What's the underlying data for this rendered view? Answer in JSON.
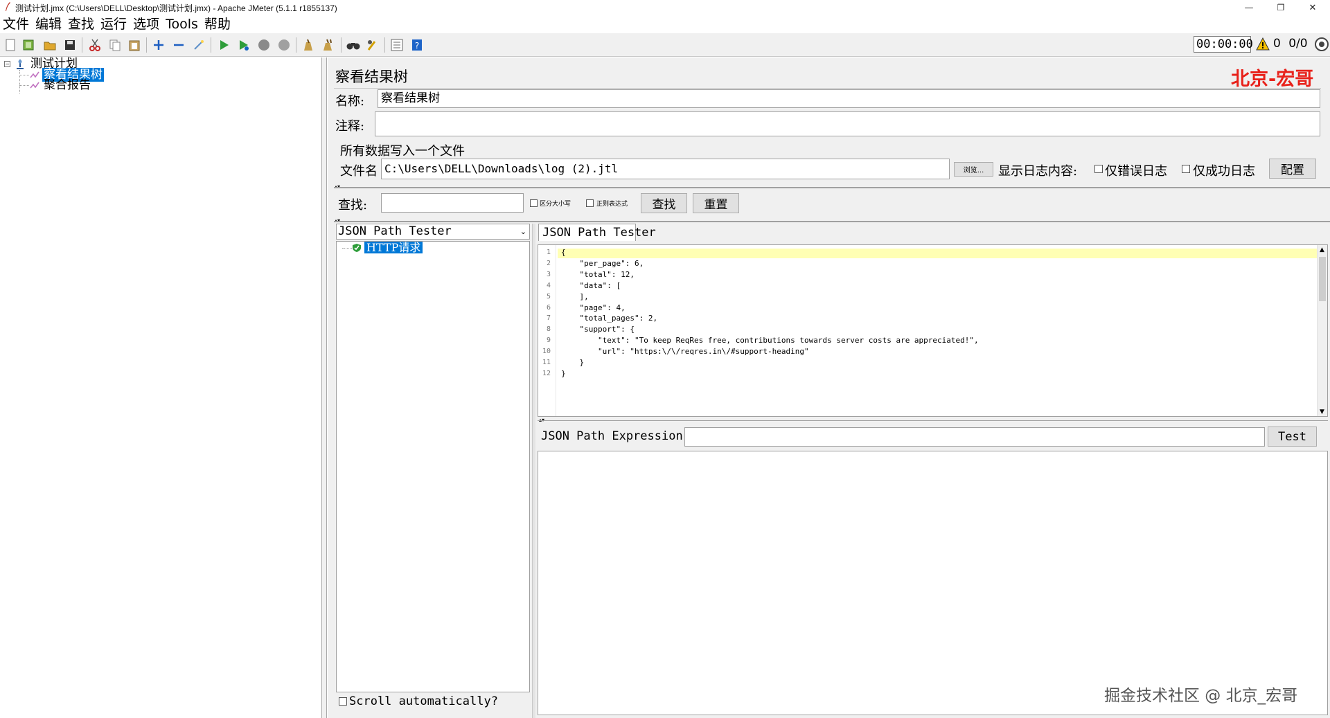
{
  "window": {
    "title": "测试计划.jmx (C:\\Users\\DELL\\Desktop\\测试计划.jmx) - Apache JMeter (5.1.1 r1855137)",
    "minimize": "—",
    "restore": "❐",
    "close": "✕"
  },
  "menu": [
    "文件",
    "编辑",
    "查找",
    "运行",
    "选项",
    "Tools",
    "帮助"
  ],
  "toolbar": {
    "icons": [
      "new-icon",
      "templates-icon",
      "open-icon",
      "save-icon",
      "cut-icon",
      "copy-icon",
      "paste-icon",
      "expand-icon",
      "collapse-icon",
      "toggle-icon",
      "start-icon",
      "start-no-pause-icon",
      "stop-icon",
      "shutdown-icon",
      "clear-icon",
      "clear-all-icon",
      "search-icon",
      "reset-search-icon",
      "function-helper-icon",
      "help-icon"
    ],
    "timer": "00:00:00",
    "warning_count": "0",
    "thread_count": "0/0"
  },
  "tree": {
    "root": "测试计划",
    "items": [
      {
        "label": "察看结果树",
        "selected": true
      },
      {
        "label": "聚合报告",
        "selected": false
      }
    ]
  },
  "panel": {
    "title": "察看结果树",
    "name_label": "名称:",
    "name_value": "察看结果树",
    "comment_label": "注释:",
    "comment_value": "",
    "write_all_label": "所有数据写入一个文件",
    "filename_label": "文件名",
    "filename_value": "C:\\Users\\DELL\\Downloads\\log (2).jtl",
    "browse_button": "浏览...",
    "log_display_label": "显示日志内容:",
    "errors_only": "仅错误日志",
    "success_only": "仅成功日志",
    "configure_button": "配置"
  },
  "search": {
    "label": "查找:",
    "value": "",
    "case_sensitive": "区分大小写",
    "regex": "正则表达式",
    "find_button": "查找",
    "reset_button": "重置"
  },
  "renderer": {
    "selected": "JSON Path Tester",
    "sample": "HTTP请求",
    "tab": "JSON Path Tester",
    "scroll_auto": "Scroll automatically?"
  },
  "response": {
    "lines": [
      "{",
      "    \"per_page\": 6,",
      "    \"total\": 12,",
      "    \"data\": [",
      "    ],",
      "    \"page\": 4,",
      "    \"total_pages\": 2,",
      "    \"support\": {",
      "        \"text\": \"To keep ReqRes free, contributions towards server costs are appreciated!\",",
      "        \"url\": \"https:\\/\\/reqres.in\\/#support-heading\"",
      "    }",
      "}"
    ]
  },
  "json_path": {
    "label": "JSON Path Expression",
    "value": "",
    "test_button": "Test"
  },
  "watermarks": {
    "top_right": "北京-宏哥",
    "bottom_right": "掘金技术社区 @ 北京_宏哥",
    "top_right_color": "#e8211a"
  }
}
